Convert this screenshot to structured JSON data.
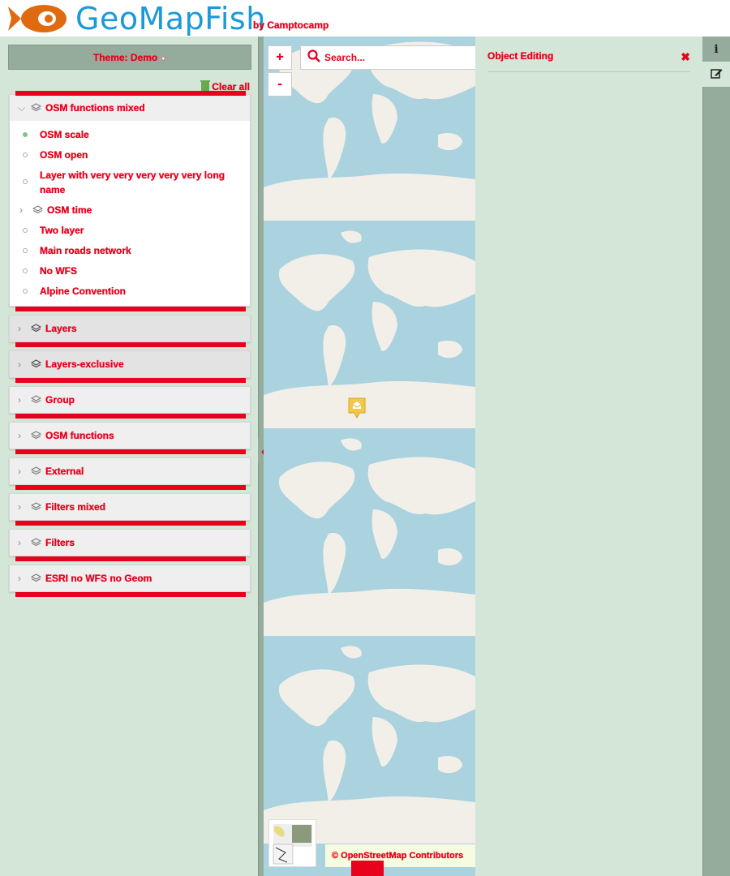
{
  "header": {
    "brand": "GeoMapFish",
    "by": "by Camptocamp"
  },
  "left_panel": {
    "theme_button": "Theme: Demo",
    "clear_all": "Clear all",
    "first_group": {
      "name": "OSM functions mixed",
      "layers": [
        "OSM scale",
        "OSM open",
        "Layer with very very very very very long name"
      ],
      "sub_group": "OSM time",
      "layers2": [
        "Two layer",
        "Main roads network",
        "No WFS",
        "Alpine Convention"
      ]
    },
    "groups": [
      "Layers",
      "Layers-exclusive",
      "Group",
      "OSM functions",
      "External",
      "Filters mixed",
      "Filters",
      "ESRI no WFS no Geom"
    ]
  },
  "map": {
    "zoom_in": "+",
    "zoom_out": "-",
    "search_placeholder": "Search...",
    "attribution": "© OpenStreetMap Contributors"
  },
  "right_panel": {
    "title": "Object Editing",
    "close": "✖"
  },
  "right_bar": {
    "info": "i"
  }
}
